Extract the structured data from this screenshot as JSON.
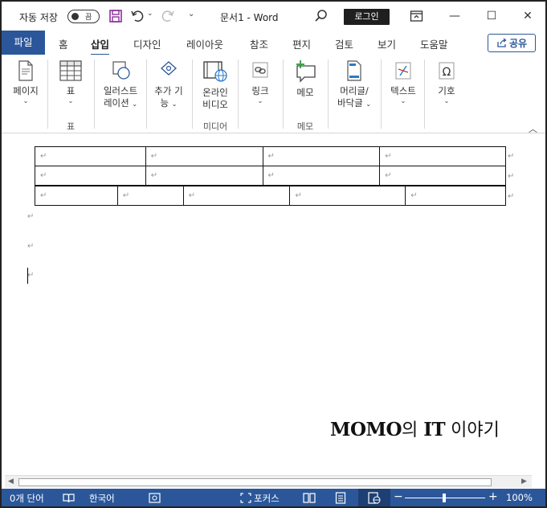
{
  "titlebar": {
    "autosave_label": "자동 저장",
    "autosave_state": "끔",
    "doc_title": "문서1  -  Word",
    "login_label": "로그인",
    "icons": [
      "save-icon",
      "undo-icon",
      "redo-icon",
      "search-icon",
      "ribbon-display-icon"
    ],
    "accent": "#2b579a"
  },
  "tabs": {
    "file": "파일",
    "items": [
      "홈",
      "삽입",
      "디자인",
      "레이아웃",
      "참조",
      "편지",
      "검토",
      "보기",
      "도움말"
    ],
    "active": "삽입",
    "share_label": "공유"
  },
  "ribbon": {
    "page": {
      "label": "페이지"
    },
    "table": {
      "label": "표",
      "group": "표"
    },
    "illustrations": {
      "line1": "일러스트",
      "line2": "레이션"
    },
    "addins": {
      "line1": "추가 기",
      "line2": "능"
    },
    "online_video": {
      "line1": "온라인",
      "line2": "비디오",
      "group": "미디어"
    },
    "link": {
      "label": "링크"
    },
    "comment": {
      "label": "메모",
      "group": "메모"
    },
    "header_footer": {
      "line1": "머리글/",
      "line2": "바닥글"
    },
    "text": {
      "label": "텍스트"
    },
    "symbols": {
      "label": "기호"
    }
  },
  "document": {
    "para_mark": "↵",
    "table_rows": [
      4,
      4,
      5
    ],
    "watermark_bold": "MOMO",
    "watermark_mid": "의 ",
    "watermark_bold2": "IT",
    "watermark_rest": " 이야기"
  },
  "statusbar": {
    "word_count": "0개 단어",
    "language": "한국어",
    "focus": "포커스",
    "zoom": "100%",
    "zoom_minus": "−",
    "zoom_plus": "+"
  }
}
